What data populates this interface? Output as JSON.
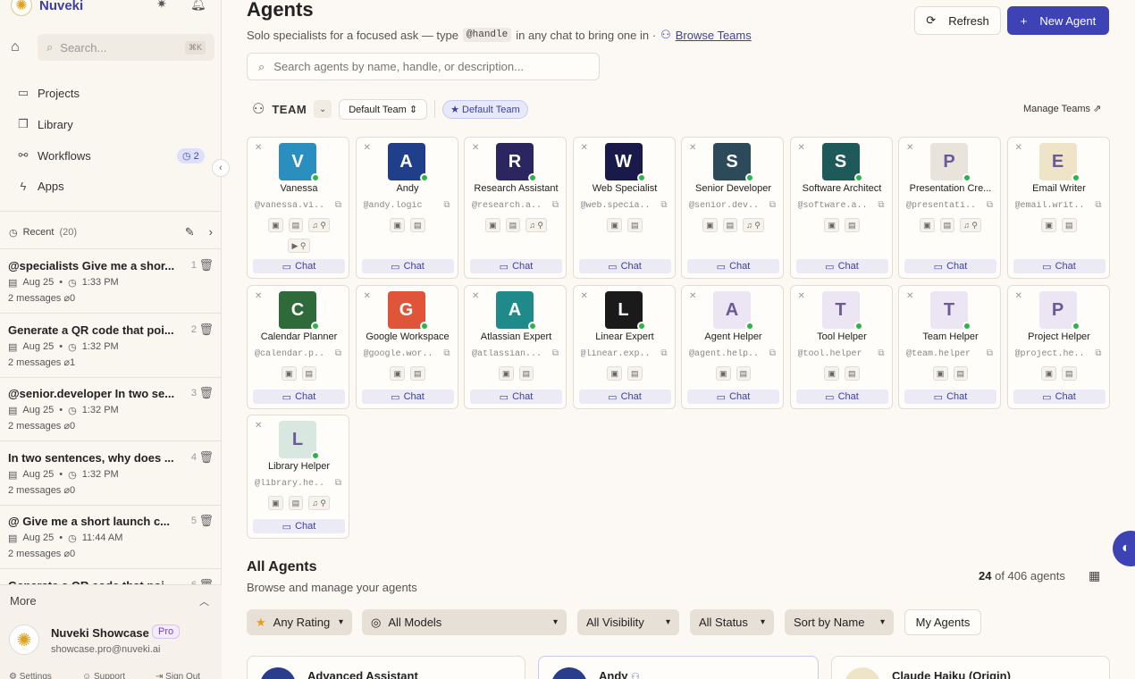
{
  "brand": {
    "name": "Nuveki",
    "logo_icon": "sun-icon"
  },
  "sidebar": {
    "search_placeholder": "Search...",
    "search_shortcut": "⌘K",
    "nav": [
      {
        "label": "Projects",
        "icon": "folder-icon"
      },
      {
        "label": "Library",
        "icon": "library-icon"
      },
      {
        "label": "Workflows",
        "icon": "workflow-icon"
      },
      {
        "label": "Apps",
        "icon": "lightning-icon"
      }
    ],
    "workflows_badge": "2",
    "recent_label": "Recent",
    "recent_count": "(20)",
    "conversations": [
      {
        "title": "@specialists Give me a shor...",
        "num": "1",
        "date": "Aug 25",
        "time": "1:33 PM",
        "messages": "2 messages",
        "attachments": "0"
      },
      {
        "title": "Generate a QR code that poi...",
        "num": "2",
        "date": "Aug 25",
        "time": "1:32 PM",
        "messages": "2 messages",
        "attachments": "1"
      },
      {
        "title": "@senior.developer In two se...",
        "num": "3",
        "date": "Aug 25",
        "time": "1:32 PM",
        "messages": "2 messages",
        "attachments": "0"
      },
      {
        "title": "In two sentences, why does ...",
        "num": "4",
        "date": "Aug 25",
        "time": "1:32 PM",
        "messages": "2 messages",
        "attachments": "0"
      },
      {
        "title": "@ Give me a short launch c...",
        "num": "5",
        "date": "Aug 25",
        "time": "11:44 AM",
        "messages": "2 messages",
        "attachments": "0"
      },
      {
        "title": "Generate a QR code that poi...",
        "num": "6",
        "date": "",
        "time": "",
        "messages": "",
        "attachments": ""
      }
    ],
    "more_label": "More",
    "user": {
      "name": "Nuveki Showcase",
      "plan": "Pro",
      "email": "showcase.pro@nuveki.ai"
    },
    "footer": [
      "Settings",
      "Support",
      "Sign Out"
    ]
  },
  "header": {
    "title": "Agents",
    "subtitle_pre": "Solo specialists for a focused ask — type",
    "subtitle_code": "@handle",
    "subtitle_post": "in any chat to bring one in ·",
    "browse_teams": "Browse Teams",
    "refresh_label": "Refresh",
    "new_agent_label": "New Agent"
  },
  "agent_search_placeholder": "Search agents by name, handle, or description...",
  "team": {
    "label": "TEAM",
    "select_value": "Default Team",
    "active_pill": "Default Team",
    "manage_label": "Manage Teams"
  },
  "chat_label": "Chat",
  "agents": [
    {
      "name": "Vanessa",
      "handle": "@vanessa.vi...",
      "color": "#2a8fbf",
      "initial": "V",
      "extra": true,
      "row2": true
    },
    {
      "name": "Andy",
      "handle": "@andy.logic",
      "color": "#1f3f8a",
      "initial": "A",
      "extra": false,
      "row2": false
    },
    {
      "name": "Research Assistant",
      "handle": "@research.a...",
      "color": "#2b2560",
      "initial": "R",
      "extra": true,
      "row2": false
    },
    {
      "name": "Web Specialist",
      "handle": "@web.specia...",
      "color": "#1a1a4a",
      "initial": "W",
      "extra": false,
      "row2": false
    },
    {
      "name": "Senior Developer",
      "handle": "@senior.dev...",
      "color": "#2d4a5a",
      "initial": "S",
      "extra": true,
      "row2": false
    },
    {
      "name": "Software Architect",
      "handle": "@software.a...",
      "color": "#1e5a5a",
      "initial": "S",
      "extra": false,
      "row2": false
    },
    {
      "name": "Presentation Cre...",
      "handle": "@presentati...",
      "color": "#e8e4dc",
      "initial": "P",
      "extra": true,
      "row2": false
    },
    {
      "name": "Email Writer",
      "handle": "@email.writ...",
      "color": "#efe3c8",
      "initial": "E",
      "extra": false,
      "row2": false
    },
    {
      "name": "Calendar Planner",
      "handle": "@calendar.p...",
      "color": "#2f6a3a",
      "initial": "C",
      "extra": false,
      "row2": false
    },
    {
      "name": "Google Workspace",
      "handle": "@google.wor...",
      "color": "#e0553a",
      "initial": "G",
      "extra": false,
      "row2": false
    },
    {
      "name": "Atlassian Expert",
      "handle": "@atlassian....",
      "color": "#1e8a8a",
      "initial": "A",
      "extra": false,
      "row2": false
    },
    {
      "name": "Linear Expert",
      "handle": "@linear.exp...",
      "color": "#1a1a1a",
      "initial": "L",
      "extra": false,
      "row2": false
    },
    {
      "name": "Agent Helper",
      "handle": "@agent.help...",
      "color": "#ece6f4",
      "initial": "A",
      "extra": false,
      "row2": false
    },
    {
      "name": "Tool Helper",
      "handle": "@tool.helper",
      "color": "#ece6f4",
      "initial": "T",
      "extra": false,
      "row2": false
    },
    {
      "name": "Team Helper",
      "handle": "@team.helper",
      "color": "#ece6f4",
      "initial": "T",
      "extra": false,
      "row2": false
    },
    {
      "name": "Project Helper",
      "handle": "@project.he...",
      "color": "#ece6f4",
      "initial": "P",
      "extra": false,
      "row2": false
    },
    {
      "name": "Library Helper",
      "handle": "@library.he...",
      "color": "#d8e8e0",
      "initial": "L",
      "extra": true,
      "row2": false
    }
  ],
  "all_agents": {
    "title": "All Agents",
    "subtitle": "Browse and manage your agents",
    "count_shown": "24",
    "count_text": "of 406 agents",
    "filters": [
      "Any Rating",
      "All Models",
      "All Visibility",
      "All Status",
      "Sort by Name"
    ],
    "my_agents": "My Agents",
    "cards": [
      "Advanced Assistant",
      "Andy",
      "Claude Haiku (Origin)"
    ]
  },
  "colors": {
    "accent": "#3d43b4",
    "online": "#2cb34a",
    "background": "#fcf8f3"
  }
}
